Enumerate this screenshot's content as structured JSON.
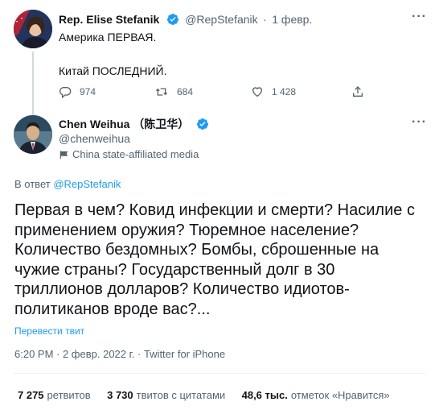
{
  "parent_tweet": {
    "author_name": "Rep. Elise Stefanik",
    "handle": "@RepStefanik",
    "separator": "·",
    "date": "1 февр.",
    "line1": "Америка ПЕРВАЯ.",
    "line2": "Китай ПОСЛЕДНИЙ.",
    "replies": "974",
    "retweets": "684",
    "likes": "1 428"
  },
  "main_tweet": {
    "author_name": "Chen Weihua （陈卫华）",
    "handle": "@chenweihua",
    "affiliation": "China state-affiliated media",
    "reply_prefix": "В ответ",
    "reply_to": "@RepStefanik",
    "text_lines": [
      "Первая в чем? Ковид инфекции и смерти? Насилие с",
      "применением оружия? Тюремное население?",
      "Количество бездомных? Бомбы, сброшенные на",
      "чужие страны? Государственный долг в 30",
      "триллионов долларов? Количество идиотов-",
      "политиканов вроде вас?..."
    ],
    "translate": "Перевести твит",
    "timestamp": "6:20 PM · 2 февр. 2022 г. · Twitter for iPhone"
  },
  "stats": {
    "retweets_count": "7 275",
    "retweets_label": "ретвитов",
    "quotes_count": "3 730",
    "quotes_label": "твитов с цитатами",
    "likes_count": "48,6 тыс.",
    "likes_label": "отметок «Нравится»"
  },
  "colors": {
    "accent": "#1d9bf0",
    "muted": "#536471",
    "text": "#0f1419",
    "divider": "#eff3f4"
  },
  "icons": [
    "verified-badge-icon",
    "more-icon",
    "reply-icon",
    "retweet-icon",
    "like-icon",
    "share-icon",
    "state-media-flag-icon"
  ]
}
